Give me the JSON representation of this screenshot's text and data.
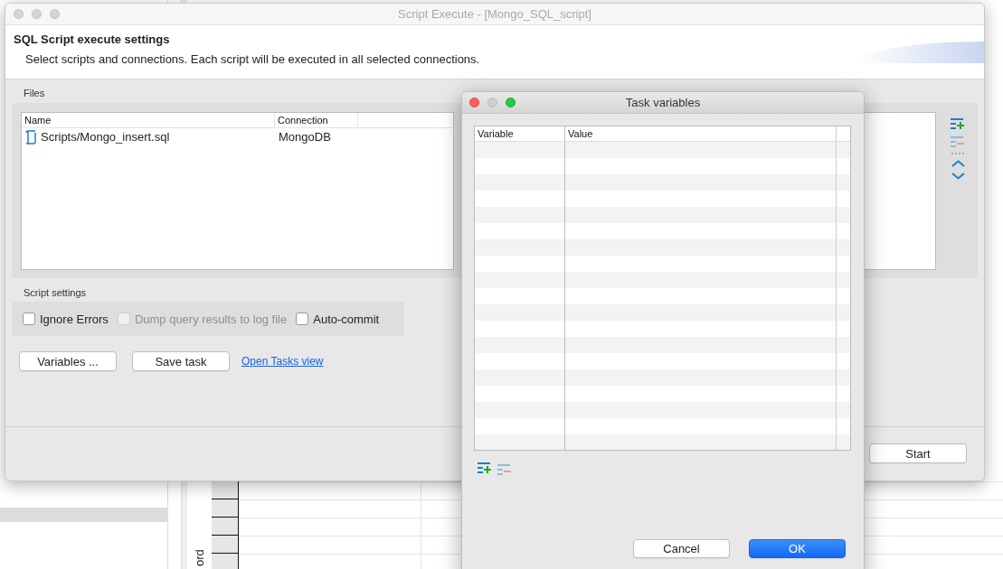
{
  "background": {
    "side_label": "ord"
  },
  "main_window": {
    "title": "Script Execute - [Mongo_SQL_script]",
    "heading": "SQL Script execute settings",
    "description": "Select scripts and connections. Each script will be executed in all selected connections.",
    "files": {
      "label": "Files",
      "columns": [
        "Name",
        "Connection"
      ],
      "rows": [
        {
          "name": "Scripts/Mongo_insert.sql",
          "connection": "MongoDB"
        }
      ]
    },
    "script_settings": {
      "label": "Script settings",
      "options": [
        {
          "label": "Ignore Errors",
          "checked": false,
          "disabled": false
        },
        {
          "label": "Dump query results to log file",
          "checked": false,
          "disabled": true
        },
        {
          "label": "Auto-commit",
          "checked": false,
          "disabled": false
        }
      ]
    },
    "buttons": [
      "Variables ...",
      "Save task"
    ],
    "link": "Open Tasks view",
    "start_button": "Start"
  },
  "dialog": {
    "title": "Task variables",
    "columns": [
      "Variable",
      "Value"
    ],
    "buttons": [
      {
        "label": "Cancel",
        "kind": "default"
      },
      {
        "label": "OK",
        "kind": "primary"
      }
    ]
  }
}
